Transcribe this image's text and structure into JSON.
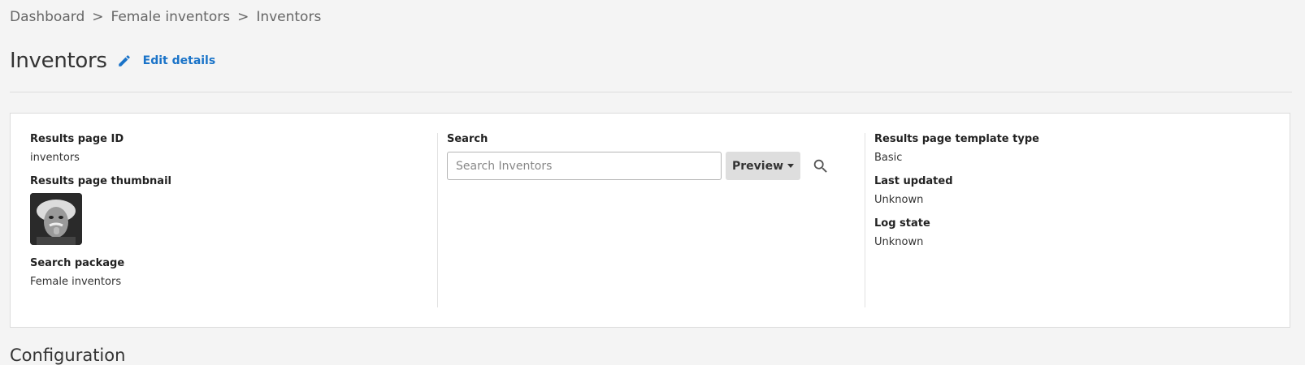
{
  "breadcrumb": {
    "items": [
      "Dashboard",
      "Female inventors",
      "Inventors"
    ],
    "separator": ">"
  },
  "header": {
    "title": "Inventors",
    "edit_label": "Edit details",
    "edit_icon": "pencil-icon",
    "accent_color": "#1a73c8"
  },
  "details": {
    "results_page_id_label": "Results page ID",
    "results_page_id": "inventors",
    "thumbnail_label": "Results page thumbnail",
    "search_package_label": "Search package",
    "search_package": "Female inventors"
  },
  "search": {
    "label": "Search",
    "placeholder": "Search Inventors",
    "value": "",
    "preview_label": "Preview",
    "search_icon": "search-icon"
  },
  "meta": {
    "template_type_label": "Results page template type",
    "template_type": "Basic",
    "last_updated_label": "Last updated",
    "last_updated": "Unknown",
    "log_state_label": "Log state",
    "log_state": "Unknown"
  },
  "configuration": {
    "heading": "Configuration"
  }
}
